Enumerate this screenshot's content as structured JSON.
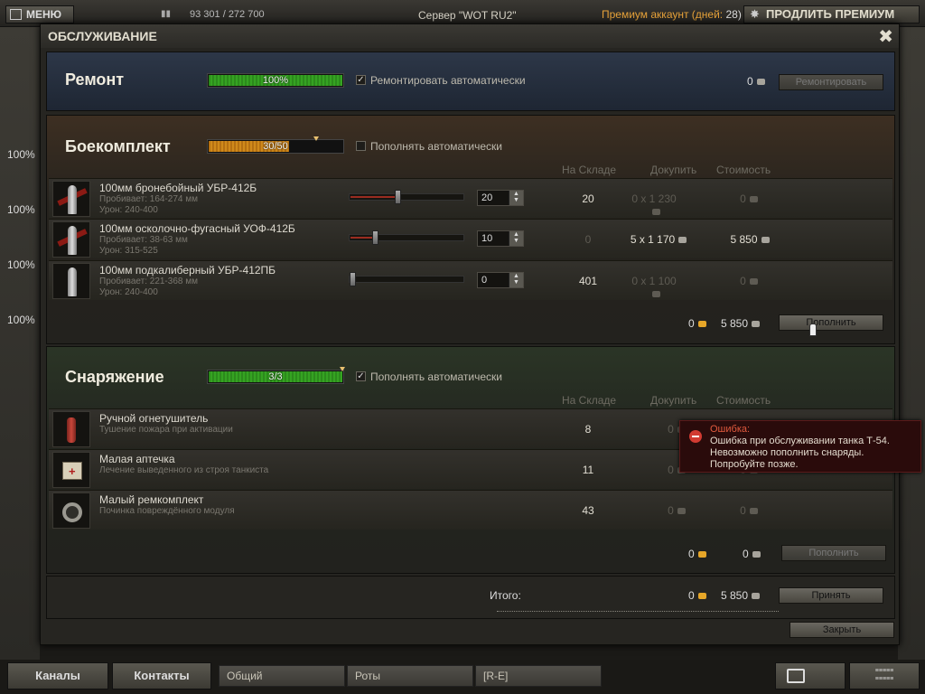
{
  "topbar": {
    "menu_label": "МЕНЮ",
    "xp": "93 301 / 272 700",
    "server": "Сервер \"WOT RU2\"",
    "premium_label": "Премиум аккаунт (дней:",
    "premium_days": "28)",
    "extend_label": "ПРОДЛИТЬ ПРЕМИУМ"
  },
  "background": {
    "health_values": [
      "100%",
      "100%",
      "100%",
      "100%"
    ]
  },
  "dialog": {
    "title": "ОБСЛУЖИВАНИЕ",
    "close_glyph": "✖",
    "repair": {
      "title": "Ремонт",
      "progress_text": "100%",
      "progress_value": 1.0,
      "auto_label": "Ремонтировать автоматически",
      "auto_checked": true,
      "cost": "0",
      "button_label": "Ремонтировать"
    },
    "ammo": {
      "title": "Боекомплект",
      "progress_text": "30/50",
      "progress_value": 0.6,
      "auto_label": "Пополнять автоматически",
      "auto_checked": false,
      "columns": {
        "stock": "На Складе",
        "buy": "Докупить",
        "cost": "Стоимость"
      },
      "rows": [
        {
          "name": "100мм бронебойный УБР-412Б",
          "pen": "Пробивает: 164-274 мм",
          "dmg": "Урон: 240-400",
          "count": "20",
          "fill": 0.42,
          "stock": "20",
          "buy": "0 x 1 230",
          "cost": "0"
        },
        {
          "name": "100мм осколочно-фугасный УОФ-412Б",
          "pen": "Пробивает: 38-63 мм",
          "dmg": "Урон: 315-525",
          "count": "10",
          "fill": 0.22,
          "stock": "0",
          "buy": "5 x 1 170",
          "cost": "5 850"
        },
        {
          "name": "100мм подкалиберный УБР-412ПБ",
          "pen": "Пробивает: 221-368 мм",
          "dmg": "Урон: 240-400",
          "count": "0",
          "fill": 0.0,
          "stock": "401",
          "buy": "0 x 1 100",
          "cost": "0"
        }
      ],
      "total_gold": "0",
      "total_credits": "5 850",
      "button_label": "Пополнить"
    },
    "equipment": {
      "title": "Снаряжение",
      "progress_text": "3/3",
      "progress_value": 1.0,
      "auto_label": "Пополнять автоматически",
      "auto_checked": true,
      "columns": {
        "stock": "На Складе",
        "buy": "Докупить",
        "cost": "Стоимость"
      },
      "rows": [
        {
          "name": "Ручной огнетушитель",
          "desc": "Тушение пожара при активации",
          "stock": "8",
          "buy": "0",
          "cost": "0"
        },
        {
          "name": "Малая аптечка",
          "desc": "Лечение выведенного из строя танкиста",
          "stock": "11",
          "buy": "0",
          "cost": "0"
        },
        {
          "name": "Малый ремкомплект",
          "desc": "Починка повреждённого модуля",
          "stock": "43",
          "buy": "0",
          "cost": "0"
        }
      ],
      "total_gold": "0",
      "total_credits": "0",
      "button_label": "Пополнить"
    },
    "total": {
      "label": "Итого:",
      "gold": "0",
      "credits": "5 850",
      "accept_label": "Принять"
    },
    "close_label": "Закрыть"
  },
  "error_tooltip": {
    "title": "Ошибка:",
    "message": "Ошибка при обслуживании танка Т-54. Невозможно пополнить снаряды. Попробуйте позже."
  },
  "bottombar": {
    "channels": "Каналы",
    "contacts": "Контакты",
    "tabs": [
      "Общий",
      "Роты",
      "[R-E]"
    ]
  }
}
